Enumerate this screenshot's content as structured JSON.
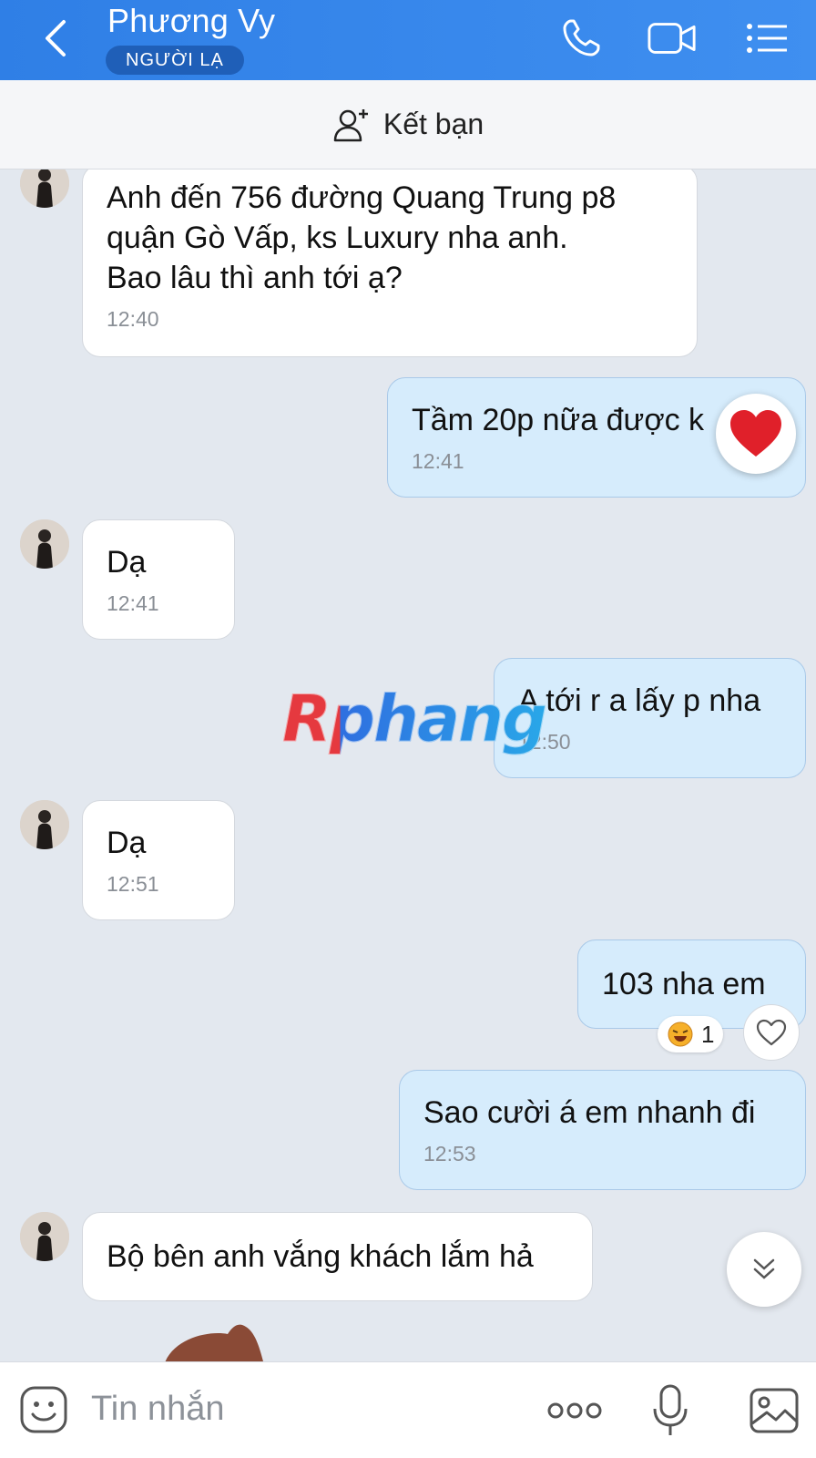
{
  "header": {
    "title": "Phương Vy",
    "badge": "NGƯỜI LẠ",
    "bg_color": "#3a88ee"
  },
  "add_friend": {
    "label": "Kết bạn"
  },
  "messages": [
    {
      "dir": "in",
      "text": "Anh đến 756 đường Quang Trung p8\nquận Gò Vấp,  ks Luxury nha anh.\nBao lâu thì anh tới ạ?",
      "time": "12:40"
    },
    {
      "dir": "out",
      "text": "Tầm 20p nữa được k",
      "time": "12:41",
      "reaction": "heart"
    },
    {
      "dir": "in",
      "text": "Dạ",
      "time": "12:41"
    },
    {
      "dir": "out",
      "text": "A tới r a lấy p nha",
      "time": "12:50"
    },
    {
      "dir": "in",
      "text": "Dạ",
      "time": "12:51"
    },
    {
      "dir": "out",
      "text": "103 nha em",
      "time": "",
      "reaction": "laughing-emoji",
      "reaction_count": "1"
    },
    {
      "dir": "out",
      "text": "Sao cười á em nhanh đi",
      "time": "12:53"
    },
    {
      "dir": "in",
      "text": "Bộ bên anh vắng khách lắm hả",
      "time": ""
    }
  ],
  "watermark": "Rphang",
  "composer": {
    "placeholder": "Tin nhắn"
  },
  "colors": {
    "incoming_bubble": "#ffffff",
    "outgoing_bubble": "#d6ecfc",
    "chat_bg": "#e3e8ef",
    "heart": "#e0202a"
  },
  "icons": [
    "back-icon",
    "phone-icon",
    "video-call-icon",
    "menu-list-icon",
    "add-friend-icon",
    "heart-icon",
    "laughing-emoji-icon",
    "like-heart-icon",
    "scroll-down-icon",
    "sticker-icon",
    "more-icon",
    "microphone-icon",
    "image-icon"
  ]
}
